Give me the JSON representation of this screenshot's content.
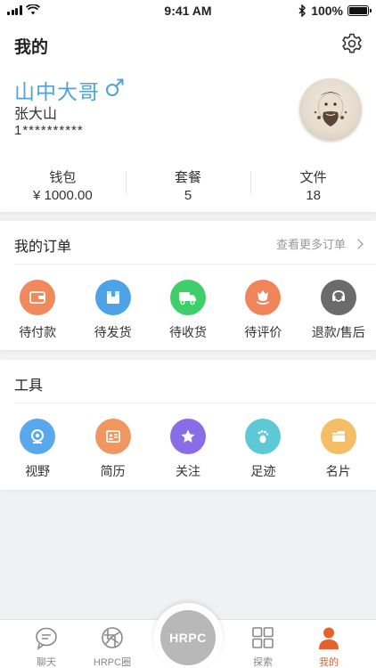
{
  "status_bar": {
    "time": "9:41 AM",
    "battery": "100%"
  },
  "header": {
    "title": "我的"
  },
  "profile": {
    "nickname": "山中大哥",
    "real_name": "张大山",
    "phone": "1**********",
    "stats": [
      {
        "label": "钱包",
        "value": "¥ 1000.00"
      },
      {
        "label": "套餐",
        "value": "5"
      },
      {
        "label": "文件",
        "value": "18"
      }
    ]
  },
  "orders": {
    "title": "我的订单",
    "more_label": "查看更多订单",
    "items": [
      {
        "label": "待付款",
        "icon": "wallet-icon",
        "color": "#f08a5d"
      },
      {
        "label": "待发货",
        "icon": "box-icon",
        "color": "#4da3e6"
      },
      {
        "label": "待收货",
        "icon": "truck-icon",
        "color": "#3fcf6a"
      },
      {
        "label": "待评价",
        "icon": "flower-icon",
        "color": "#f0855a"
      },
      {
        "label": "退款/售后",
        "icon": "service-icon",
        "color": "#6b6b6b"
      }
    ]
  },
  "tools": {
    "title": "工具",
    "items": [
      {
        "label": "视野",
        "icon": "camera-icon",
        "color": "#5aa8ec"
      },
      {
        "label": "简历",
        "icon": "resume-icon",
        "color": "#f0975f"
      },
      {
        "label": "关注",
        "icon": "star-icon",
        "color": "#8a6de6"
      },
      {
        "label": "足迹",
        "icon": "footprint-icon",
        "color": "#5ec9d6"
      },
      {
        "label": "名片",
        "icon": "card-icon",
        "color": "#f5bd65"
      }
    ]
  },
  "tabbar": {
    "items": [
      {
        "label": "聊天"
      },
      {
        "label": "HRPC圈"
      },
      {
        "label": "探索"
      },
      {
        "label": "我的"
      }
    ],
    "center_label": "HRPC",
    "active_color": "#e8612c"
  }
}
